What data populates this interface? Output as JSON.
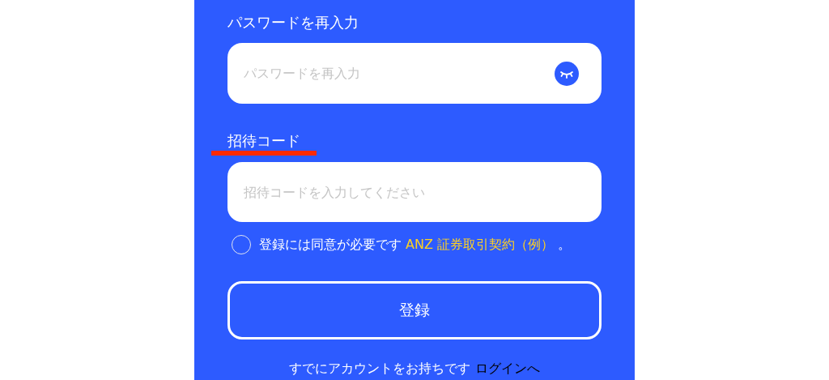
{
  "fields": [
    {
      "label": "パスワードを再入力",
      "label_underlined": false,
      "placeholder": "パスワードを再入力",
      "kind": "password"
    },
    {
      "label": "招待コード",
      "label_underlined": true,
      "placeholder": "招待コードを入力してください",
      "kind": "text"
    }
  ],
  "agreement": {
    "checked": false,
    "text": "登録には同意が必要です",
    "link": "ANZ 証券取引契約（例）",
    "suffix": "。"
  },
  "register_button": "登録",
  "footer": {
    "text": "すでにアカウントをお持ちです",
    "link": "ログインへ"
  }
}
